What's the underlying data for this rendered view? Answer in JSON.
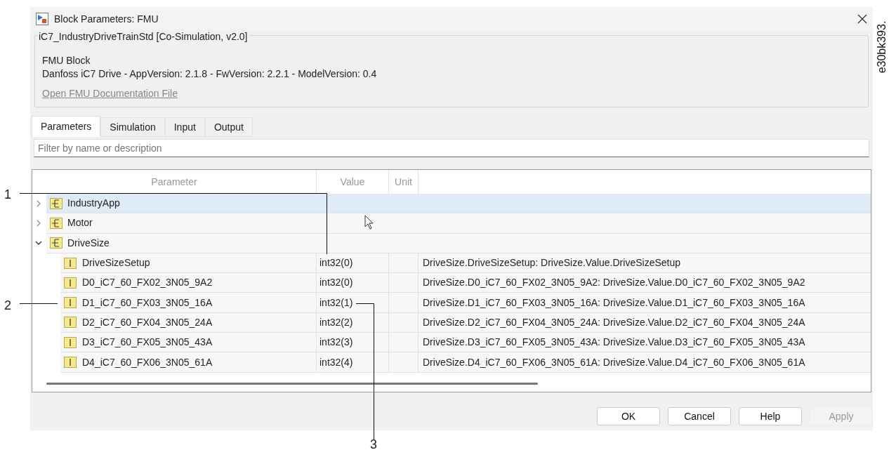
{
  "window": {
    "title": "Block Parameters: FMU"
  },
  "header": {
    "group_title": "iC7_IndustryDriveTrainStd [Co-Simulation, v2.0]",
    "block_type": "FMU Block",
    "description": "Danfoss iC7 Drive - AppVersion: 2.1.8 - FwVersion: 2.2.1 - ModelVersion: 0.4",
    "link": "Open FMU Documentation File"
  },
  "tabs": [
    {
      "label": "Parameters",
      "selected": true
    },
    {
      "label": "Simulation",
      "selected": false
    },
    {
      "label": "Input",
      "selected": false
    },
    {
      "label": "Output",
      "selected": false
    }
  ],
  "filter": {
    "placeholder": "Filter by name or description"
  },
  "table": {
    "columns": [
      "Parameter",
      "Value",
      "Unit"
    ],
    "rows": [
      {
        "name": "IndustryApp",
        "kind": "group",
        "expanded": false,
        "selected": true
      },
      {
        "name": "Motor",
        "kind": "group",
        "expanded": false,
        "selected": false
      },
      {
        "name": "DriveSize",
        "kind": "group",
        "expanded": true,
        "selected": false,
        "children": [
          {
            "name": "DriveSizeSetup",
            "kind": "param",
            "value": "int32(0)",
            "description": "DriveSize.DriveSizeSetup: DriveSize.Value.DriveSizeSetup",
            "selected": false
          },
          {
            "name": "D0_iC7_60_FX02_3N05_9A2",
            "kind": "param",
            "value": "int32(0)",
            "description": "DriveSize.D0_iC7_60_FX02_3N05_9A2: DriveSize.Value.D0_iC7_60_FX02_3N05_9A2",
            "selected": false
          },
          {
            "name": "D1_iC7_60_FX03_3N05_16A",
            "kind": "param",
            "value": "int32(1)",
            "description": "DriveSize.D1_iC7_60_FX03_3N05_16A: DriveSize.Value.D1_iC7_60_FX03_3N05_16A",
            "selected": false
          },
          {
            "name": "D2_iC7_60_FX04_3N05_24A",
            "kind": "param",
            "value": "int32(2)",
            "description": "DriveSize.D2_iC7_60_FX04_3N05_24A: DriveSize.Value.D2_iC7_60_FX04_3N05_24A",
            "selected": false
          },
          {
            "name": "D3_iC7_60_FX05_3N05_43A",
            "kind": "param",
            "value": "int32(3)",
            "description": "DriveSize.D3_iC7_60_FX05_3N05_43A: DriveSize.Value.D3_iC7_60_FX05_3N05_43A",
            "selected": false
          },
          {
            "name": "D4_iC7_60_FX06_3N05_61A",
            "kind": "param",
            "value": "int32(4)",
            "description": "DriveSize.D4_iC7_60_FX06_3N05_61A: DriveSize.Value.D4_iC7_60_FX06_3N05_61A",
            "selected": false
          }
        ]
      }
    ]
  },
  "buttons": [
    {
      "label": "OK",
      "disabled": false
    },
    {
      "label": "Cancel",
      "disabled": false
    },
    {
      "label": "Help",
      "disabled": false
    },
    {
      "label": "Apply",
      "disabled": true
    }
  ],
  "callouts": [
    "1",
    "2",
    "3"
  ],
  "figure_id": "e30bk393."
}
